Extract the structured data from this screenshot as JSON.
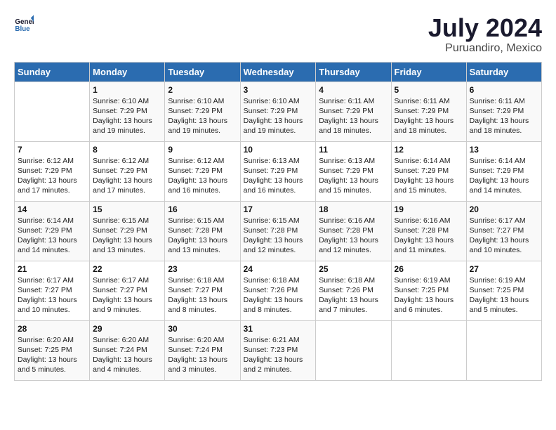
{
  "header": {
    "logo_line1": "General",
    "logo_line2": "Blue",
    "month": "July 2024",
    "location": "Puruandiro, Mexico"
  },
  "weekdays": [
    "Sunday",
    "Monday",
    "Tuesday",
    "Wednesday",
    "Thursday",
    "Friday",
    "Saturday"
  ],
  "weeks": [
    [
      {
        "day": "",
        "info": ""
      },
      {
        "day": "1",
        "info": "Sunrise: 6:10 AM\nSunset: 7:29 PM\nDaylight: 13 hours\nand 19 minutes."
      },
      {
        "day": "2",
        "info": "Sunrise: 6:10 AM\nSunset: 7:29 PM\nDaylight: 13 hours\nand 19 minutes."
      },
      {
        "day": "3",
        "info": "Sunrise: 6:10 AM\nSunset: 7:29 PM\nDaylight: 13 hours\nand 19 minutes."
      },
      {
        "day": "4",
        "info": "Sunrise: 6:11 AM\nSunset: 7:29 PM\nDaylight: 13 hours\nand 18 minutes."
      },
      {
        "day": "5",
        "info": "Sunrise: 6:11 AM\nSunset: 7:29 PM\nDaylight: 13 hours\nand 18 minutes."
      },
      {
        "day": "6",
        "info": "Sunrise: 6:11 AM\nSunset: 7:29 PM\nDaylight: 13 hours\nand 18 minutes."
      }
    ],
    [
      {
        "day": "7",
        "info": "Sunrise: 6:12 AM\nSunset: 7:29 PM\nDaylight: 13 hours\nand 17 minutes."
      },
      {
        "day": "8",
        "info": "Sunrise: 6:12 AM\nSunset: 7:29 PM\nDaylight: 13 hours\nand 17 minutes."
      },
      {
        "day": "9",
        "info": "Sunrise: 6:12 AM\nSunset: 7:29 PM\nDaylight: 13 hours\nand 16 minutes."
      },
      {
        "day": "10",
        "info": "Sunrise: 6:13 AM\nSunset: 7:29 PM\nDaylight: 13 hours\nand 16 minutes."
      },
      {
        "day": "11",
        "info": "Sunrise: 6:13 AM\nSunset: 7:29 PM\nDaylight: 13 hours\nand 15 minutes."
      },
      {
        "day": "12",
        "info": "Sunrise: 6:14 AM\nSunset: 7:29 PM\nDaylight: 13 hours\nand 15 minutes."
      },
      {
        "day": "13",
        "info": "Sunrise: 6:14 AM\nSunset: 7:29 PM\nDaylight: 13 hours\nand 14 minutes."
      }
    ],
    [
      {
        "day": "14",
        "info": "Sunrise: 6:14 AM\nSunset: 7:29 PM\nDaylight: 13 hours\nand 14 minutes."
      },
      {
        "day": "15",
        "info": "Sunrise: 6:15 AM\nSunset: 7:29 PM\nDaylight: 13 hours\nand 13 minutes."
      },
      {
        "day": "16",
        "info": "Sunrise: 6:15 AM\nSunset: 7:28 PM\nDaylight: 13 hours\nand 13 minutes."
      },
      {
        "day": "17",
        "info": "Sunrise: 6:15 AM\nSunset: 7:28 PM\nDaylight: 13 hours\nand 12 minutes."
      },
      {
        "day": "18",
        "info": "Sunrise: 6:16 AM\nSunset: 7:28 PM\nDaylight: 13 hours\nand 12 minutes."
      },
      {
        "day": "19",
        "info": "Sunrise: 6:16 AM\nSunset: 7:28 PM\nDaylight: 13 hours\nand 11 minutes."
      },
      {
        "day": "20",
        "info": "Sunrise: 6:17 AM\nSunset: 7:27 PM\nDaylight: 13 hours\nand 10 minutes."
      }
    ],
    [
      {
        "day": "21",
        "info": "Sunrise: 6:17 AM\nSunset: 7:27 PM\nDaylight: 13 hours\nand 10 minutes."
      },
      {
        "day": "22",
        "info": "Sunrise: 6:17 AM\nSunset: 7:27 PM\nDaylight: 13 hours\nand 9 minutes."
      },
      {
        "day": "23",
        "info": "Sunrise: 6:18 AM\nSunset: 7:27 PM\nDaylight: 13 hours\nand 8 minutes."
      },
      {
        "day": "24",
        "info": "Sunrise: 6:18 AM\nSunset: 7:26 PM\nDaylight: 13 hours\nand 8 minutes."
      },
      {
        "day": "25",
        "info": "Sunrise: 6:18 AM\nSunset: 7:26 PM\nDaylight: 13 hours\nand 7 minutes."
      },
      {
        "day": "26",
        "info": "Sunrise: 6:19 AM\nSunset: 7:25 PM\nDaylight: 13 hours\nand 6 minutes."
      },
      {
        "day": "27",
        "info": "Sunrise: 6:19 AM\nSunset: 7:25 PM\nDaylight: 13 hours\nand 5 minutes."
      }
    ],
    [
      {
        "day": "28",
        "info": "Sunrise: 6:20 AM\nSunset: 7:25 PM\nDaylight: 13 hours\nand 5 minutes."
      },
      {
        "day": "29",
        "info": "Sunrise: 6:20 AM\nSunset: 7:24 PM\nDaylight: 13 hours\nand 4 minutes."
      },
      {
        "day": "30",
        "info": "Sunrise: 6:20 AM\nSunset: 7:24 PM\nDaylight: 13 hours\nand 3 minutes."
      },
      {
        "day": "31",
        "info": "Sunrise: 6:21 AM\nSunset: 7:23 PM\nDaylight: 13 hours\nand 2 minutes."
      },
      {
        "day": "",
        "info": ""
      },
      {
        "day": "",
        "info": ""
      },
      {
        "day": "",
        "info": ""
      }
    ]
  ]
}
